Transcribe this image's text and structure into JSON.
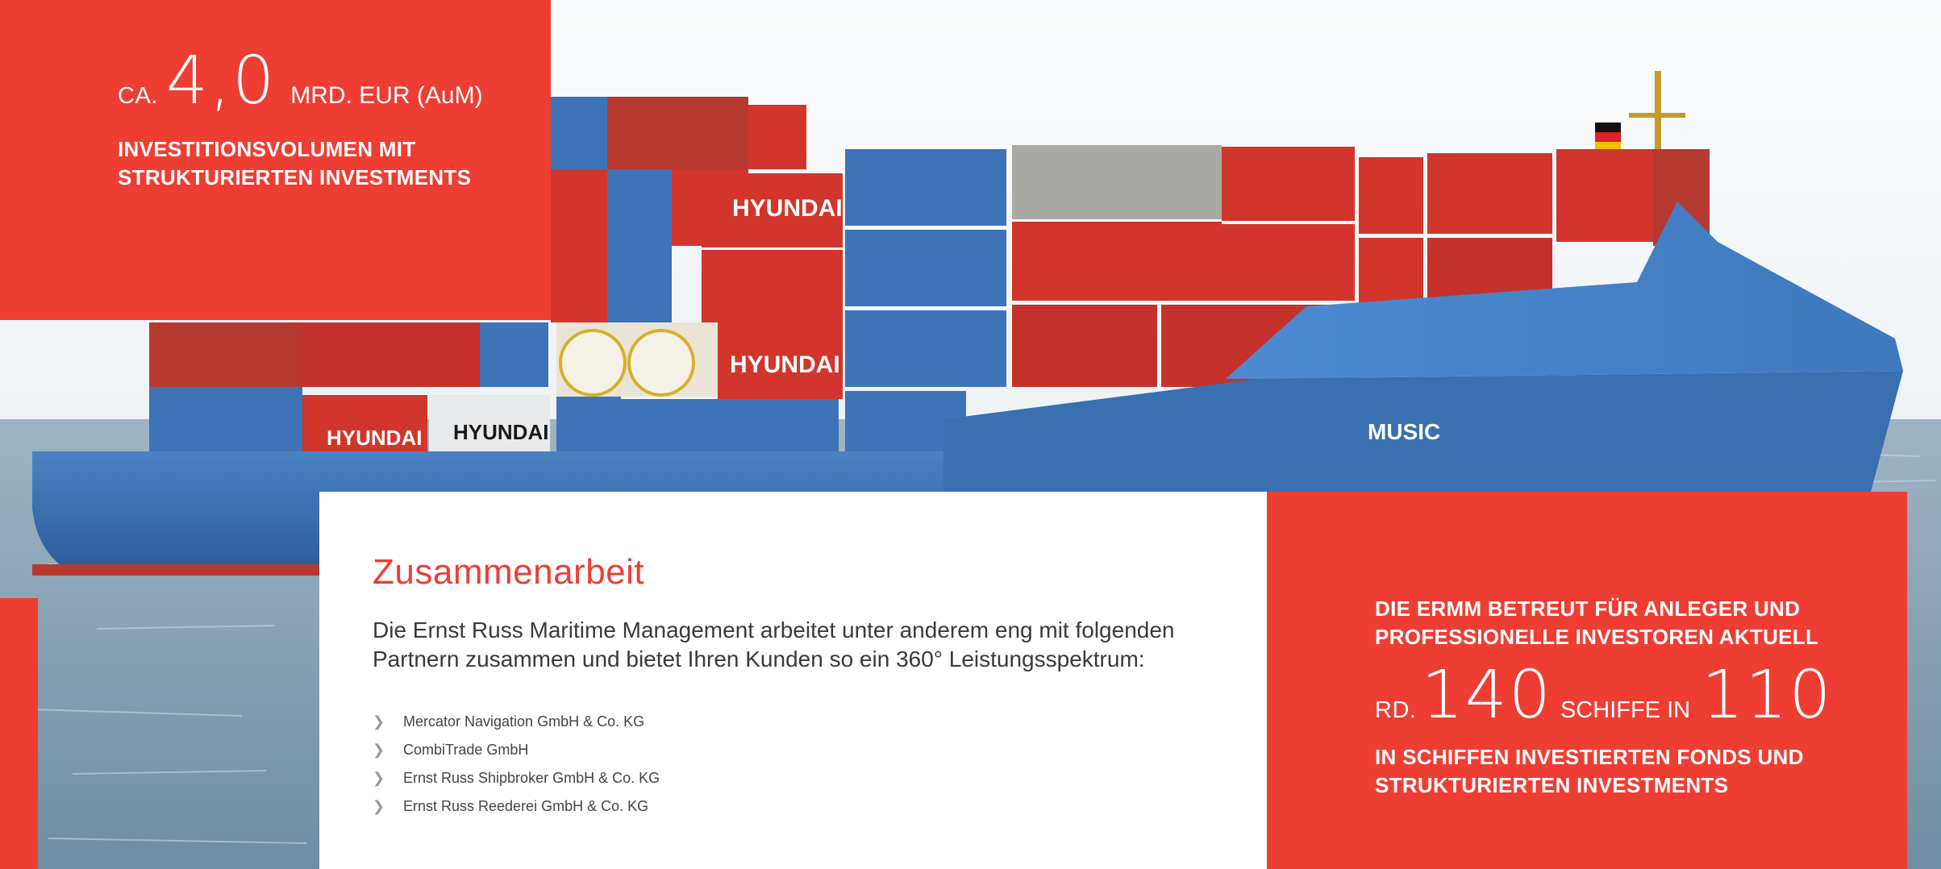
{
  "top_stat": {
    "prefix": "CA.",
    "number": "4,0",
    "suffix": "MRD. EUR (AuM)",
    "caption_line1": "INVESTITIONSVOLUMEN MIT",
    "caption_line2": "STRUKTURIERTEN INVESTMENTS"
  },
  "hero": {
    "ship_name": "MUSIC",
    "container_brand": "HYUNDAI"
  },
  "content": {
    "title": "Zusammenarbeit",
    "desc_line1": "Die Ernst Russ Maritime Management arbeitet unter anderem eng mit folgenden",
    "desc_line2": "Partnern zusammen und bietet Ihren Kunden so ein 360° Leistungsspektrum:",
    "partners": [
      "Mercator Navigation GmbH & Co. KG",
      "CombiTrade GmbH",
      "Ernst Russ Shipbroker GmbH & Co. KG",
      "Ernst Russ Reederei GmbH & Co. KG"
    ]
  },
  "right_stat": {
    "caption_line1": "DIE ERMM BETREUT FÜR ANLEGER UND",
    "caption_line2": "PROFESSIONELLE INVESTOREN AKTUELL",
    "prefix": "RD.",
    "number1": "140",
    "mid": "SCHIFFE IN",
    "number2": "110",
    "bottom_line1": "IN SCHIFFEN INVESTIERTEN FONDS UND",
    "bottom_line2": "STRUKTURIERTEN INVESTMENTS"
  },
  "colors": {
    "accent": "#ee3e34",
    "hull_blue": "#3a6fb0",
    "container_red": "#d2352c",
    "container_blue": "#3f73b8",
    "sea": "#8fa7b8"
  }
}
